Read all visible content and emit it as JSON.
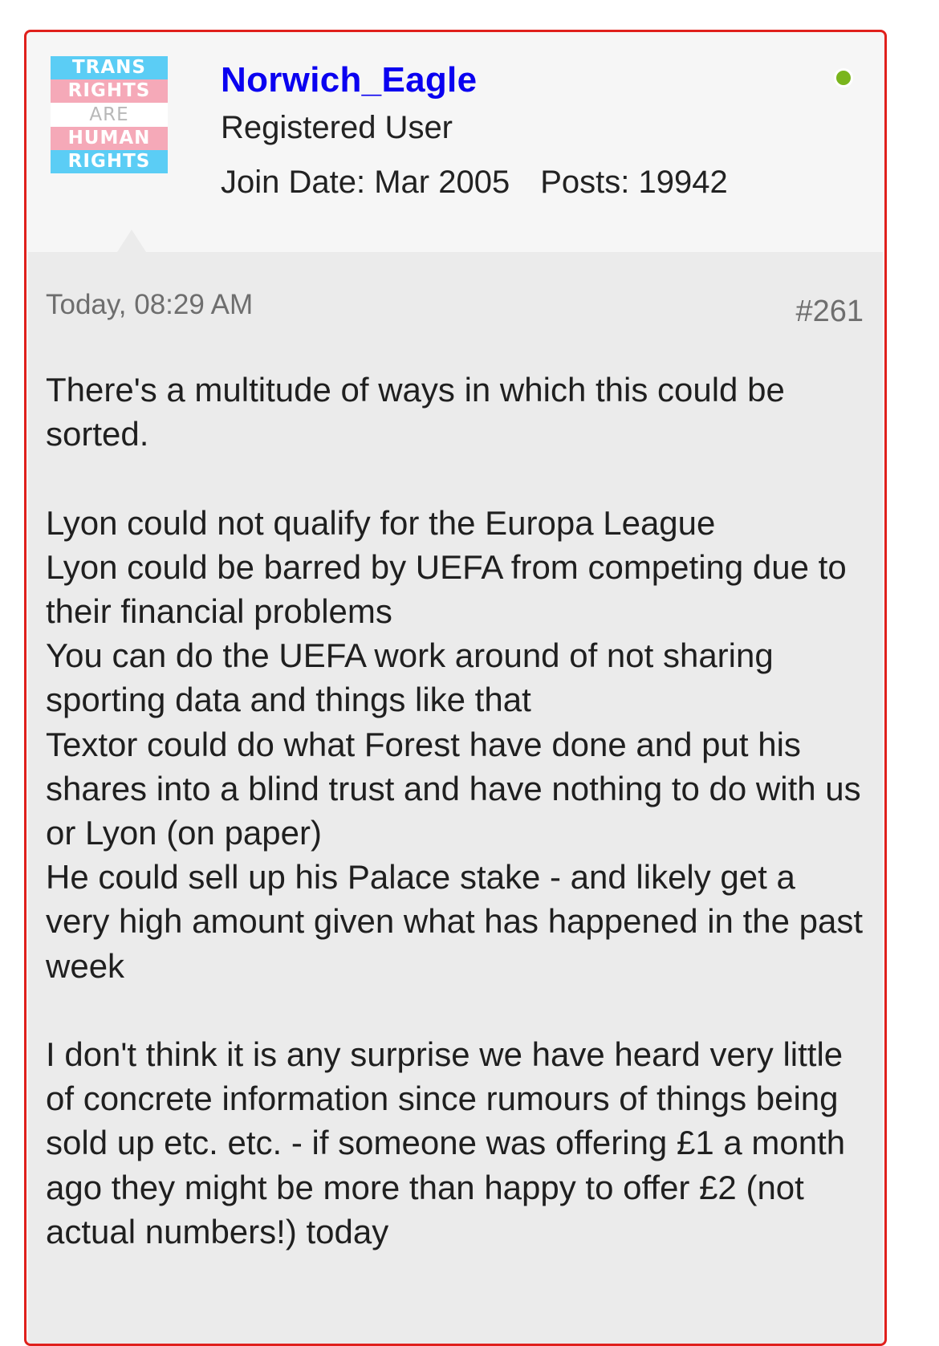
{
  "post": {
    "avatar": {
      "lines": [
        "TRANS",
        "RIGHTS",
        "ARE",
        "HUMAN",
        "RIGHTS"
      ]
    },
    "username": "Norwich_Eagle",
    "user_title": "Registered User",
    "join_date": "Join Date: Mar 2005",
    "posts": "Posts: 19942",
    "online_status_color": "#7ab51d",
    "timestamp": "Today, 08:29 AM",
    "post_number": "#261",
    "message": {
      "p1": "There's a multitude of ways in which this could be sorted.",
      "list": [
        "Lyon could not qualify for the Europa League",
        "Lyon could be barred by UEFA from competing due to their financial problems",
        "You can do the UEFA work around of not sharing sporting data and things like that",
        "Textor could do what Forest have done and put his shares into a blind trust and have nothing to do with us or Lyon (on paper)",
        "He could sell up his Palace stake - and likely get a very high amount given what has happened in the past week"
      ],
      "p3": "I don't think it is any surprise we have heard very little of concrete information since rumours of things being sold up etc. etc. - if someone was offering £1 a month ago they might be more than happy to offer £2 (not actual numbers!) today"
    }
  }
}
